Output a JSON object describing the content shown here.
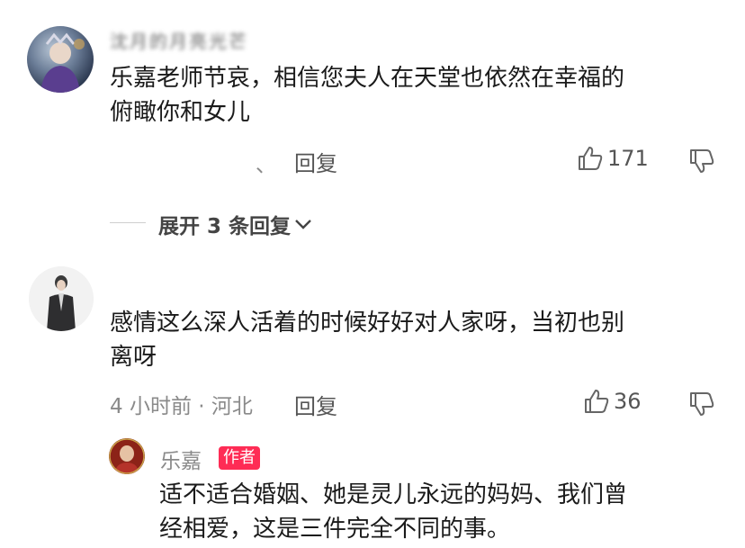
{
  "comments": [
    {
      "username": "沈月的月亮光芒",
      "text_line1": "乐嘉老师节哀，相信您夫人在天堂也依然在幸福的",
      "text_line2": "俯瞰你和女儿",
      "meta_sep": "、",
      "reply_label": "回复",
      "likes": "171",
      "expand_label": "展开 3 条回复"
    },
    {
      "text_line1": "感情这么深人活着的时候好好对人家呀，当初也别",
      "text_line2": "离呀",
      "time_location": "4 小时前 · 河北",
      "reply_label": "回复",
      "likes": "36"
    }
  ],
  "reply": {
    "username": "乐嘉",
    "badge": "作者",
    "text_line1": "适不适合婚姻、她是灵儿永远的妈妈、我们曾",
    "text_line2": "经相爱，这是三件完全不同的事。"
  },
  "colors": {
    "badge": "#fe2c55",
    "text": "#1a1a1a",
    "meta": "#8a8a8a"
  }
}
